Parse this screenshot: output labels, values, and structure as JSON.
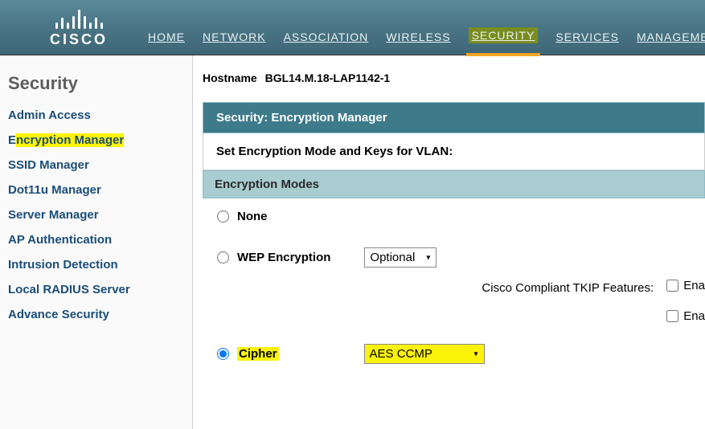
{
  "brand": "CISCO",
  "nav": {
    "home": "HOME",
    "network": "NETWORK",
    "association": "ASSOCIATION",
    "wireless": "WIRELESS",
    "security": "SECURITY",
    "services": "SERVICES",
    "management": "MANAGEMENT"
  },
  "sidebar": {
    "title": "Security",
    "items": [
      "Admin Access",
      "Encryption Manager",
      "SSID Manager",
      "Dot11u Manager",
      "Server Manager",
      "AP Authentication",
      "Intrusion Detection",
      "Local RADIUS Server",
      "Advance Security"
    ]
  },
  "hostname": {
    "label": "Hostname",
    "value": "BGL14.M.18-LAP1142-1"
  },
  "panel": {
    "title": "Security: Encryption Manager",
    "subtitle": "Set Encryption Mode and Keys for VLAN:"
  },
  "section": {
    "title": "Encryption Modes"
  },
  "modes": {
    "none": "None",
    "wep": "WEP Encryption",
    "cipher": "Cipher",
    "selected": "cipher"
  },
  "wep": {
    "option": "Optional"
  },
  "tkip": {
    "label": "Cisco Compliant TKIP Features:",
    "ena1": "Ena",
    "ena2": "Ena"
  },
  "cipher": {
    "option": "AES CCMP"
  }
}
